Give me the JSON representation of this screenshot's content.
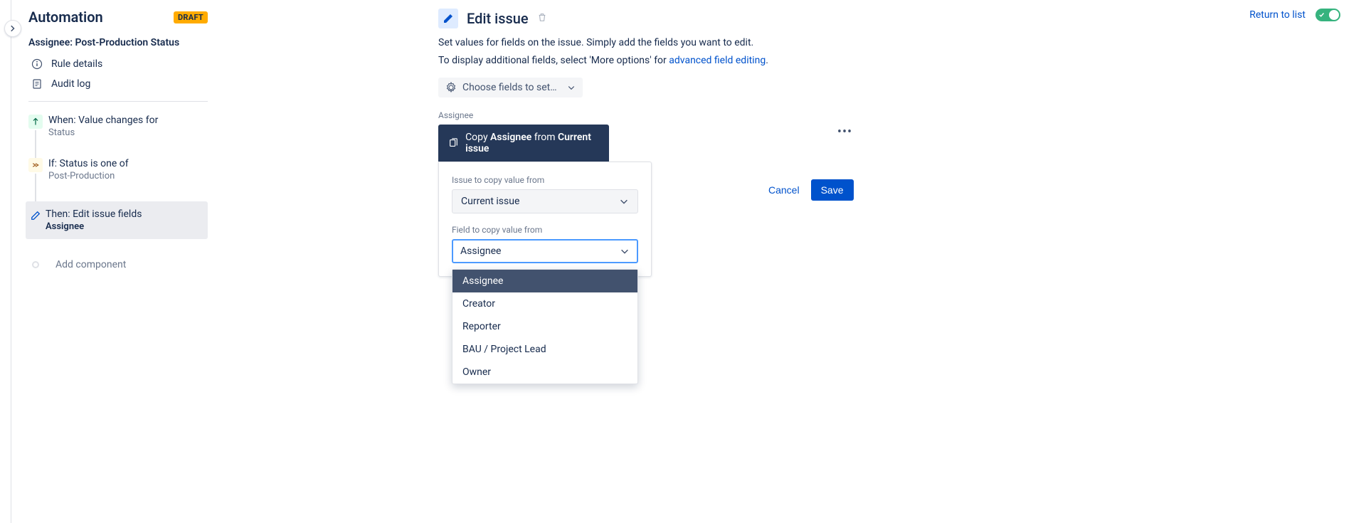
{
  "header": {
    "title": "Automation",
    "draft_badge": "DRAFT",
    "return_link": "Return to list"
  },
  "sidebar": {
    "subtitle": "Assignee: Post-Production Status",
    "rule_details": "Rule details",
    "audit_log": "Audit log",
    "step_when_title": "When: Value changes for",
    "step_when_sub": "Status",
    "step_if_title": "If: Status is one of",
    "step_if_sub": "Post-Production",
    "step_then_title": "Then: Edit issue fields",
    "step_then_sub": "Assignee",
    "add_component": "Add component"
  },
  "panel": {
    "title": "Edit issue",
    "desc1": "Set values for fields on the issue. Simply add the fields you want to edit.",
    "desc2_prefix": "To display additional fields, select 'More options' for ",
    "desc2_link": "advanced field editing",
    "choose_fields": "Choose fields to set…",
    "field_label": "Assignee",
    "copy_text_copy": "Copy ",
    "copy_text_field": "Assignee",
    "copy_text_from": " from ",
    "copy_text_issue": "Current issue",
    "issue_from_label": "Issue to copy value from",
    "issue_from_value": "Current issue",
    "field_from_label": "Field to copy value from",
    "field_from_value": "Assignee",
    "options": [
      "Assignee",
      "Creator",
      "Reporter",
      "BAU / Project Lead",
      "Owner"
    ],
    "cancel": "Cancel",
    "save": "Save"
  }
}
